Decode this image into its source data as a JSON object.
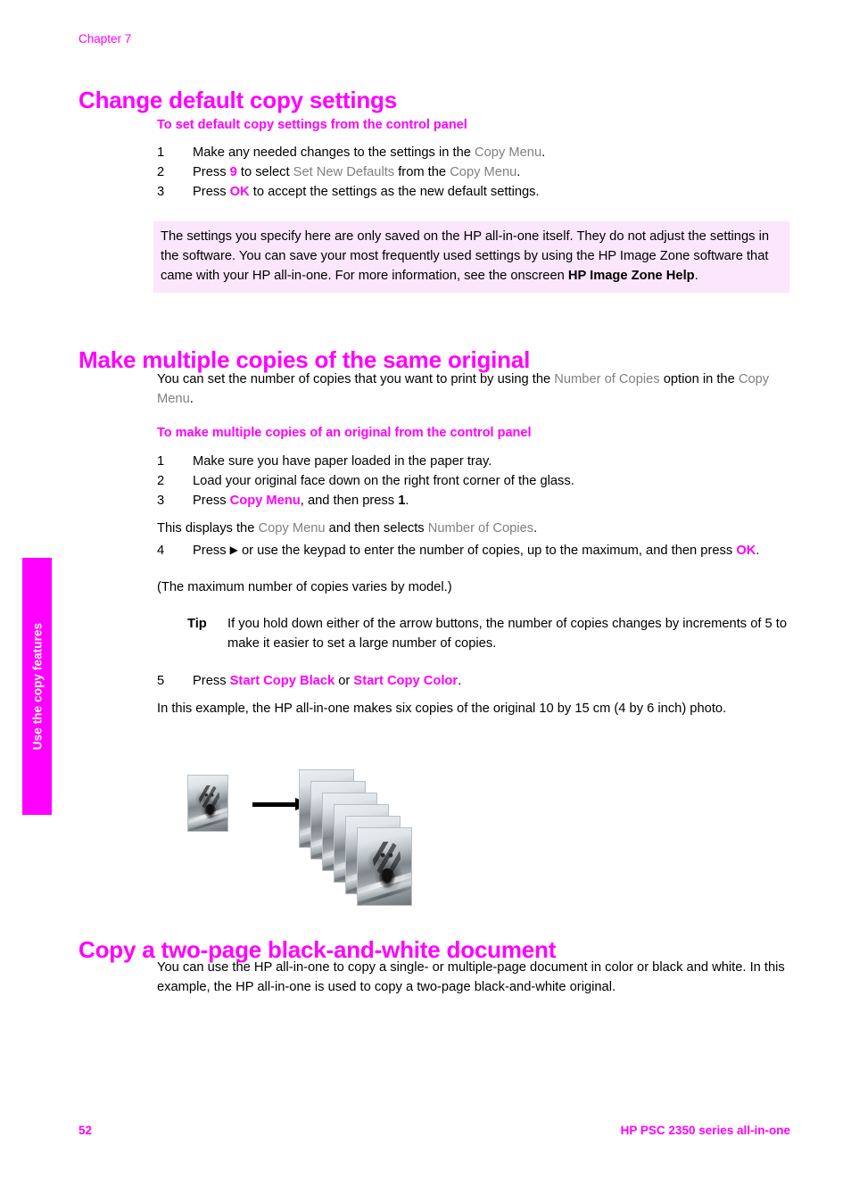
{
  "side_tab": {
    "label": "Use the copy features",
    "bg_color": "#ff00ff",
    "text_color": "#ffffff"
  },
  "chapter": {
    "label": "Chapter 7"
  },
  "colors": {
    "accent": "#ff00ff",
    "ui_reference_gray": "#808080",
    "note_background": "#fbe6fb",
    "body_text": "#000000"
  },
  "sections": {
    "change_defaults": {
      "heading": "Change default copy settings",
      "subheading": "To set default copy settings from the control panel",
      "steps": [
        {
          "number": "1",
          "parts": [
            {
              "text": "Make any needed changes to the settings in the ",
              "style": "plain"
            },
            {
              "text": "Copy Menu",
              "style": "gray"
            },
            {
              "text": ".",
              "style": "plain"
            }
          ]
        },
        {
          "number": "2",
          "parts": [
            {
              "text": "Press ",
              "style": "plain"
            },
            {
              "text": "9",
              "style": "pink"
            },
            {
              "text": " to select ",
              "style": "plain"
            },
            {
              "text": "Set New Defaults",
              "style": "gray"
            },
            {
              "text": " from the ",
              "style": "plain"
            },
            {
              "text": "Copy Menu",
              "style": "gray"
            },
            {
              "text": ".",
              "style": "plain"
            }
          ]
        },
        {
          "number": "3",
          "parts": [
            {
              "text": "Press ",
              "style": "plain"
            },
            {
              "text": "OK",
              "style": "pink"
            },
            {
              "text": " to accept the settings as the new default settings.",
              "style": "plain"
            }
          ]
        }
      ],
      "note": {
        "parts": [
          {
            "text": "The settings you specify here are only saved on the HP all-in-one itself. They do not adjust the settings in the software. You can save your most frequently used settings by using the HP Image Zone software that came with your HP all-in-one. For more information, see the onscreen ",
            "style": "plain"
          },
          {
            "text": "HP Image Zone Help",
            "style": "bold"
          },
          {
            "text": ".",
            "style": "plain"
          }
        ]
      }
    },
    "multiple_copies": {
      "heading": "Make multiple copies of the same original",
      "intro_parts": [
        {
          "text": "You can set the number of copies that you want to print by using the ",
          "style": "plain"
        },
        {
          "text": "Number of Copies",
          "style": "gray"
        },
        {
          "text": " option in the ",
          "style": "plain"
        },
        {
          "text": "Copy Menu",
          "style": "gray"
        },
        {
          "text": ".",
          "style": "plain"
        }
      ],
      "subheading": "To make multiple copies of an original from the control panel",
      "steps": [
        {
          "number": "1",
          "parts": [
            {
              "text": "Make sure you have paper loaded in the paper tray.",
              "style": "plain"
            }
          ]
        },
        {
          "number": "2",
          "parts": [
            {
              "text": "Load your original face down on the right front corner of the glass.",
              "style": "plain"
            }
          ]
        },
        {
          "number": "3",
          "parts": [
            {
              "text": "Press ",
              "style": "plain"
            },
            {
              "text": "Copy Menu",
              "style": "pink"
            },
            {
              "text": ", and then press ",
              "style": "plain"
            },
            {
              "text": "1",
              "style": "bold"
            },
            {
              "text": ".",
              "style": "plain"
            }
          ]
        }
      ],
      "step3_note_parts": [
        {
          "text": "This displays the ",
          "style": "plain"
        },
        {
          "text": "Copy Menu",
          "style": "gray"
        },
        {
          "text": " and then selects ",
          "style": "plain"
        },
        {
          "text": "Number of Copies",
          "style": "gray"
        },
        {
          "text": ".",
          "style": "plain"
        }
      ],
      "step4": {
        "number": "4",
        "parts": [
          {
            "text": "Press ",
            "style": "plain"
          },
          {
            "text": "▶",
            "style": "glyph"
          },
          {
            "text": " or use the keypad to enter the number of copies, up to the maximum, and then press ",
            "style": "plain"
          },
          {
            "text": "OK",
            "style": "pink"
          },
          {
            "text": ".",
            "style": "plain"
          }
        ]
      },
      "step4_note": "(The maximum number of copies varies by model.)",
      "tip": {
        "label": "Tip",
        "text": "If you hold down either of the arrow buttons, the number of copies changes by increments of 5 to make it easier to set a large number of copies."
      },
      "step5": {
        "number": "5",
        "parts": [
          {
            "text": "Press ",
            "style": "plain"
          },
          {
            "text": "Start Copy Black",
            "style": "pink"
          },
          {
            "text": " or ",
            "style": "plain"
          },
          {
            "text": "Start Copy Color",
            "style": "pink"
          },
          {
            "text": ".",
            "style": "plain"
          }
        ]
      },
      "example_text": "In this example, the HP all-in-one makes six copies of the original 10 by 15 cm (4 by 6 inch) photo.",
      "figure": {
        "original_label": "original-photo",
        "arrow_label": "right-arrow",
        "copies_count": 6
      }
    },
    "two_page_doc": {
      "heading": "Copy a two-page black-and-white document",
      "body": "You can use the HP all-in-one to copy a single- or multiple-page document in color or black and white. In this example, the HP all-in-one is used to copy a two-page black-and-white original."
    }
  },
  "footer": {
    "page_number": "52",
    "product": "HP PSC 2350 series all-in-one"
  }
}
